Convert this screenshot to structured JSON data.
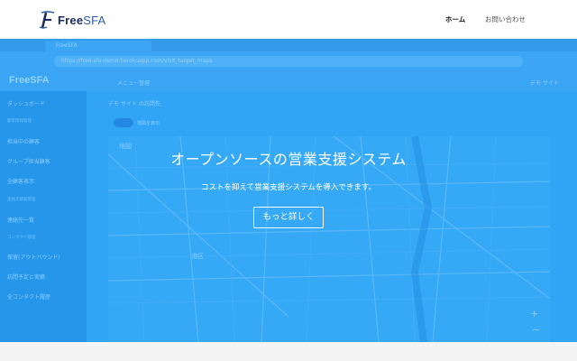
{
  "brand": {
    "name_prefix": "Free",
    "name_suffix": "SFA",
    "color": "#1b2b5e"
  },
  "nav": {
    "home": "ホーム",
    "contact": "お問い合わせ"
  },
  "hero": {
    "background": "#2fa8f7",
    "headline": "オープンソースの営業支援システム",
    "subline": "コストを抑えて営業支援システムを導入できます。",
    "cta": "もっと詳しく"
  },
  "screenshot": {
    "tab_title": "FreeSFA",
    "url": "https://free-sfa-demo.herokuapp.com/visit_target_maps",
    "app_logo": "FreeSFA",
    "app_menu": "メニュー管理",
    "app_right": "デモ サイト",
    "breadcrumb": "デモ サイト の訪問先",
    "toggle_label": "地図を表示",
    "sidebar": [
      {
        "type": "item",
        "label": "ダッシュボード"
      },
      {
        "type": "head",
        "label": "顧客情報管理"
      },
      {
        "type": "item",
        "label": "担当中の顧客"
      },
      {
        "type": "item",
        "label": "グループ担当顧客"
      },
      {
        "type": "item",
        "label": "全顧客表示"
      },
      {
        "type": "head",
        "label": "連絡先情報管理"
      },
      {
        "type": "item",
        "label": "連絡先一覧"
      },
      {
        "type": "head",
        "label": "コンタクト管理"
      },
      {
        "type": "item",
        "label": "保留(アウトバウンド)"
      },
      {
        "type": "item",
        "label": "訪問予定と実績"
      },
      {
        "type": "item",
        "label": "全コンタクト履歴"
      }
    ],
    "map_labels": [
      "地図",
      "港区",
      "+",
      "−"
    ]
  }
}
